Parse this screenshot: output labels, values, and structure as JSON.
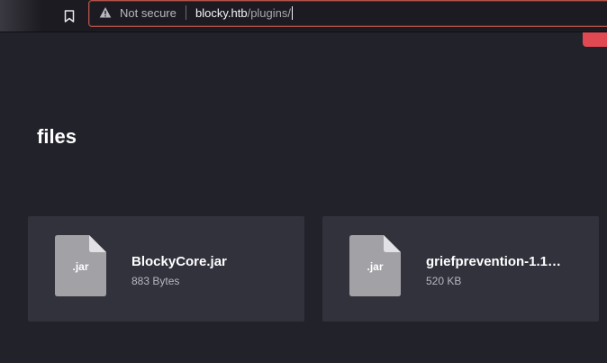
{
  "browser": {
    "security_label": "Not secure",
    "url_host": "blocky.htb",
    "url_path": "/plugins/",
    "icons": [
      "bookmark-icon",
      "warning-icon"
    ]
  },
  "page": {
    "title": "files"
  },
  "files": [
    {
      "ext": ".jar",
      "name": "BlockyCore.jar",
      "size": "883 Bytes",
      "icon": "file-icon"
    },
    {
      "ext": ".jar",
      "name": "griefprevention-1.1…",
      "size": "520 KB",
      "icon": "file-icon"
    }
  ],
  "colors": {
    "background": "#22222b",
    "card": "#32323d",
    "file_icon": "#a1a1a6",
    "accent_red": "#e04852"
  }
}
